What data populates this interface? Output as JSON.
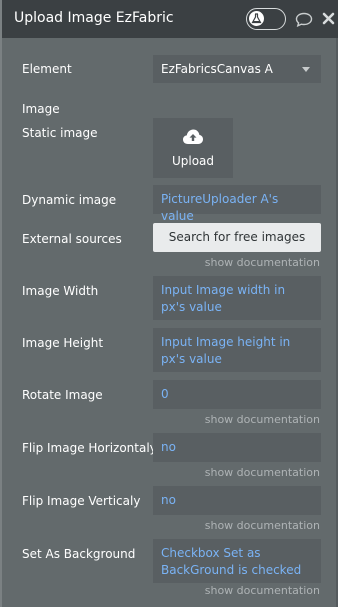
{
  "header": {
    "title": "Upload Image EzFabricsC",
    "toggle_icon": "flask-icon",
    "comment_icon": "speech-bubble-icon",
    "close_icon": "close-icon"
  },
  "rows": {
    "element": {
      "label": "Element",
      "value": "EzFabricsCanvas A"
    },
    "image": {
      "label": "Image"
    },
    "static_image": {
      "label": "Static image",
      "upload_label": "Upload"
    },
    "dynamic_image": {
      "label": "Dynamic image",
      "value": "PictureUploader A's value"
    },
    "external_sources": {
      "label": "External sources",
      "button": "Search for free images"
    },
    "image_width": {
      "label": "Image Width",
      "value": "Input Image width in px's value"
    },
    "image_height": {
      "label": "Image Height",
      "value": "Input Image height in px's value"
    },
    "rotate_image": {
      "label": "Rotate Image",
      "value": "0"
    },
    "flip_h": {
      "label": "Flip Image Horizontaly",
      "value": "no"
    },
    "flip_v": {
      "label": "Flip Image Verticaly",
      "value": "no"
    },
    "background": {
      "label": "Set As Background",
      "value": "Checkbox Set as BackGround is checked"
    }
  },
  "show_documentation": "show documentation",
  "colors": {
    "header_bg": "#3b4043",
    "panel_bg": "#636a6c",
    "field_bg": "#595f62",
    "dynamic_text": "#7ab3f5"
  }
}
